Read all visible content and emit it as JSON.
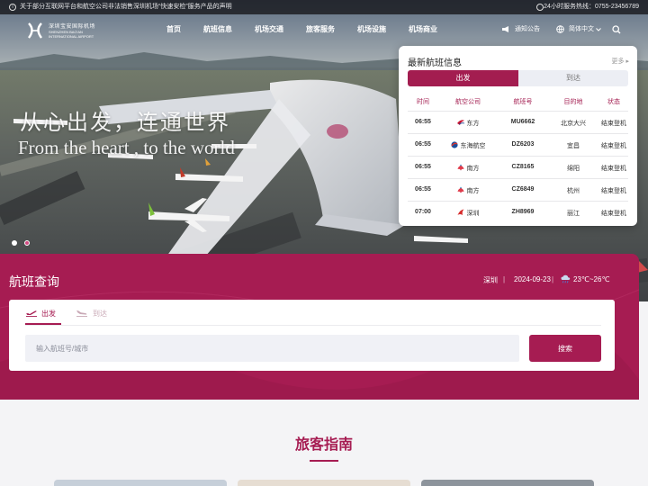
{
  "notice": {
    "icon": "info-icon",
    "text": "关于部分互联网平台和航空公司非法销售深圳机场“快速安检”服务产品的声明",
    "hotline": "24小时服务热线：0755-23456789"
  },
  "header": {
    "logo": {
      "cn": "深圳宝安国际机场",
      "en1": "SHENZHEN BAO'AN",
      "en2": "INTERNATIONAL AIRPORT"
    },
    "nav": [
      "首页",
      "航班信息",
      "机场交通",
      "旅客服务",
      "机场设施",
      "机场商业"
    ],
    "notice_label": "通知公告",
    "language": "简体中文",
    "language_chevron": "chevron-down-icon",
    "search_icon": "search-icon"
  },
  "hero": {
    "slogan_cn": "从心出发，连通世界",
    "slogan_en": "From the heart , to the world"
  },
  "flight_panel": {
    "title": "最新航班信息",
    "more": "更多 ▸",
    "tabs": [
      "出发",
      "到达"
    ],
    "columns": [
      "时间",
      "航空公司",
      "航班号",
      "目的地",
      "状态"
    ],
    "rows": [
      {
        "time": "06:55",
        "airline": "东方",
        "icon": "china-eastern-icon",
        "flight": "MU6662",
        "dest": "北京大兴",
        "status": "结束登机"
      },
      {
        "time": "06:55",
        "airline": "东海航空",
        "icon": "donghai-airlines-icon",
        "flight": "DZ6203",
        "dest": "宜昌",
        "status": "结束登机"
      },
      {
        "time": "06:55",
        "airline": "南方",
        "icon": "china-southern-icon",
        "flight": "CZ8165",
        "dest": "绵阳",
        "status": "结束登机"
      },
      {
        "time": "06:55",
        "airline": "南方",
        "icon": "china-southern-icon",
        "flight": "CZ6849",
        "dest": "杭州",
        "status": "结束登机"
      },
      {
        "time": "07:00",
        "airline": "深圳",
        "icon": "shenzhen-airlines-icon",
        "flight": "ZH8969",
        "dest": "丽江",
        "status": "结束登机"
      }
    ]
  },
  "flight_search": {
    "title": "航班查询",
    "city": "深圳",
    "sep": "|",
    "date": "2024-09-23",
    "weather": "23℃~26℃",
    "tabs": [
      "出发",
      "到达"
    ],
    "placeholder": "输入航班号/城市",
    "button": "搜索"
  },
  "guide": {
    "title": "旅客指南"
  },
  "colors": {
    "brand": "#a61c52",
    "panel_header": "#a31d50"
  }
}
